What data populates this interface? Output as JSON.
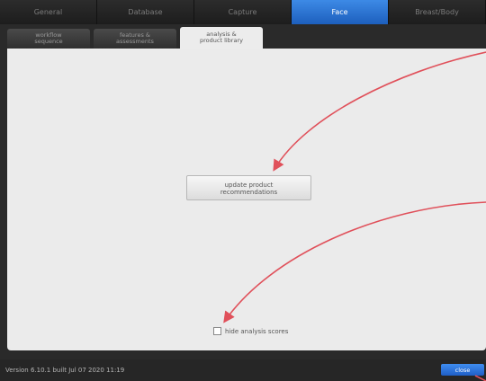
{
  "top_tabs": [
    {
      "label": "General"
    },
    {
      "label": "Database"
    },
    {
      "label": "Capture"
    },
    {
      "label": "Face"
    },
    {
      "label": "Breast/Body"
    }
  ],
  "sub_tabs": [
    {
      "line1": "workflow",
      "line2": "sequence"
    },
    {
      "line1": "features &",
      "line2": "assessments"
    },
    {
      "line1": "analysis &",
      "line2": "product library"
    }
  ],
  "main": {
    "update_button_line1": "update product",
    "update_button_line2": "recommendations",
    "hide_scores_label": "hide analysis scores",
    "hide_scores_checked": false
  },
  "footer": {
    "version": "Version 6.10.1 built Jul 07 2020 11:19",
    "close_label": "close"
  },
  "colors": {
    "active_tab": "#2f74d8",
    "annotation_arrow": "#e0505a"
  }
}
